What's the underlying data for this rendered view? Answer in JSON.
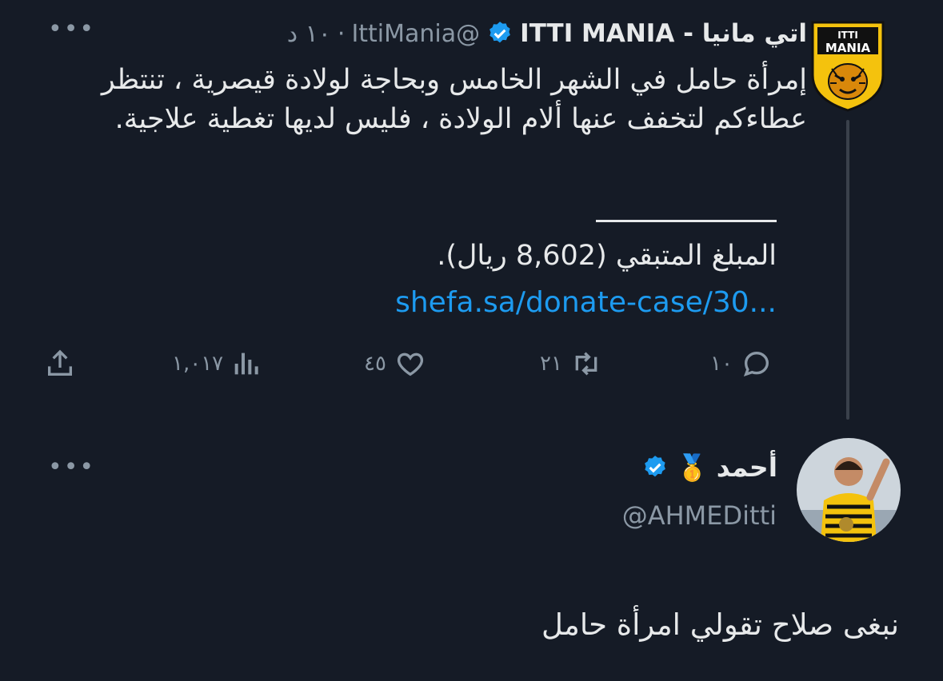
{
  "tweet": {
    "name": "اتي مانيا - ITTI MANIA",
    "handle": "@IttiMania",
    "time": "١٠ د",
    "avatar_top_text": "ITTI",
    "avatar_main_text": "MANIA",
    "text": "إمرأة حامل في الشهر الخامس وبحاجة لولادة قيصرية ، تنتظر عطاءكم لتخفف عنها ألام الولادة ، فليس لديها تغطية علاجية.",
    "amount_text": "المبلغ المتبقي (8,602 ريال).",
    "link": "shefa.sa/donate-case/30...",
    "more_icon": "more-dots-icon",
    "actions": {
      "replies": "١٠",
      "retweets": "٢١",
      "likes": "٤٥",
      "views": "١,٠١٧"
    }
  },
  "reply": {
    "name": "أحمد",
    "emoji": "🥇",
    "handle": "@AHMEDitti",
    "text": "نبغى صلاح تقولي امرأة حامل",
    "more_icon": "more-dots-icon"
  },
  "colors": {
    "background": "#151b26",
    "text": "#e7e9ea",
    "muted": "#8b98a5",
    "link": "#1d9bf0",
    "verified": "#1d9bf0",
    "badge_yellow": "#f4c20d"
  }
}
